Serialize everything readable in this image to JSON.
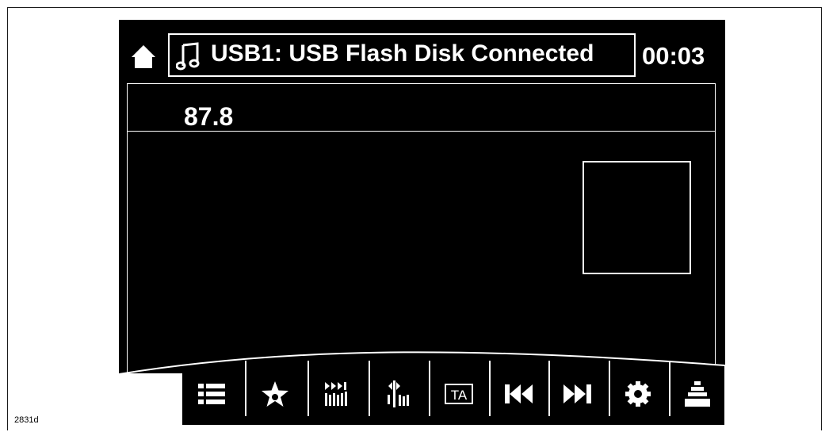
{
  "header": {
    "source_status": "USB1: USB Flash Disk Connected",
    "clock": "00:03"
  },
  "main": {
    "frequency": "87.8"
  },
  "toolbar": {
    "ta_label": "TA"
  },
  "caption": "2831d",
  "colors": {
    "background": "#000000",
    "foreground": "#ffffff"
  }
}
